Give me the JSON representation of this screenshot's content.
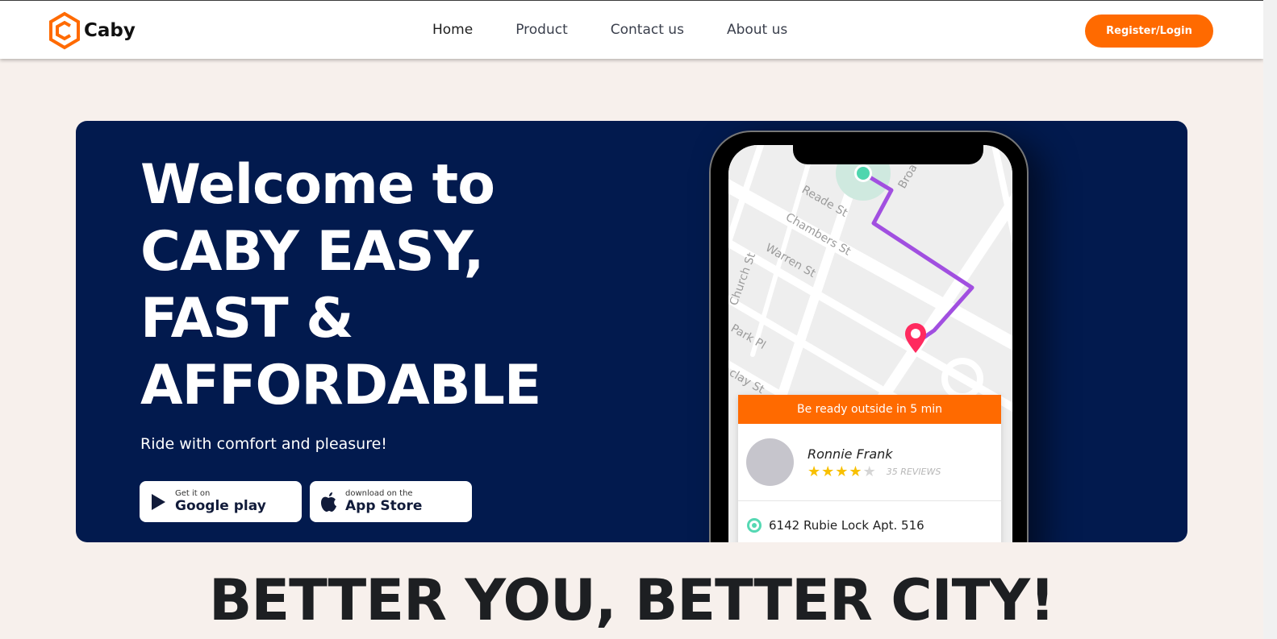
{
  "header": {
    "brand_name": "Caby",
    "nav": [
      {
        "label": "Home"
      },
      {
        "label": "Product"
      },
      {
        "label": "Contact us"
      },
      {
        "label": "About us"
      }
    ],
    "register_label": "Register/Login"
  },
  "hero": {
    "title_lines": [
      "Welcome to",
      "CABY EASY,",
      "FAST &",
      "AFFORDABLE"
    ],
    "subtitle": "Ride with comfort and pleasure!",
    "google_play": {
      "small": "Get it on",
      "big": "Google play"
    },
    "app_store": {
      "small": "download on the",
      "big": "App Store"
    }
  },
  "phone": {
    "map_streets": [
      "Reade St",
      "Chambers St",
      "Warren St",
      "Church St",
      "Park Pl",
      "Broa",
      "clay St"
    ],
    "card": {
      "banner": "Be ready outside in 5 min",
      "driver_name": "Ronnie Frank",
      "rating": 4,
      "rating_max": 5,
      "reviews": "35 REVIEWS",
      "address": "6142 Rubie Lock Apt. 516"
    }
  },
  "tagline": "BETTER YOU, BETTER CITY!",
  "colors": {
    "accent": "#ff6a00",
    "hero_bg": "#021a4e",
    "page_bg": "#f7f0ec"
  }
}
